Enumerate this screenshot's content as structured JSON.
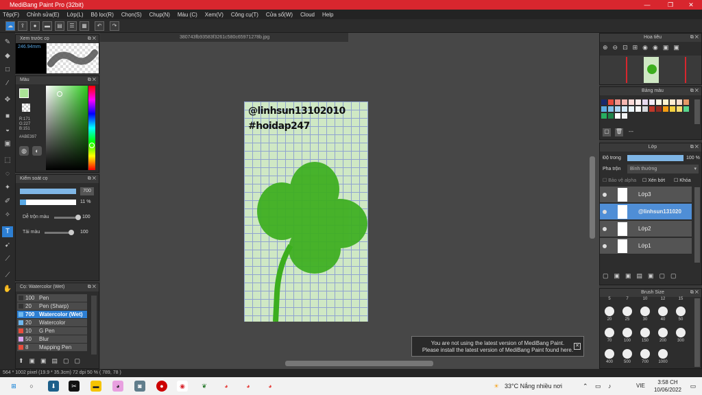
{
  "window": {
    "title": "MediBang Paint Pro (32bit)",
    "minimize": "—",
    "maximize": "❐",
    "close": "✕"
  },
  "menu": [
    "Tệp(F)",
    "Chỉnh sửa(E)",
    "Lớp(L)",
    "Bộ lọc(R)",
    "Chọn(S)",
    "Chụp(N)",
    "Màu (C)",
    "Xem(V)",
    "Công cụ(T)",
    "Cửa sổ(W)",
    "Cloud",
    "Help"
  ],
  "toolbar": {
    "undo": "↶",
    "redo": "↷"
  },
  "brush_preview": {
    "title": "Xem trước cọ",
    "size": "246.94mm"
  },
  "color": {
    "title": "Màu",
    "r": "R:171",
    "g": "G:227",
    "b": "B:151",
    "hex": "#ABE397",
    "value": "#ABE397"
  },
  "brush_control": {
    "title": "Kiểm soát cọ",
    "size_value": "700",
    "opacity_value": "11 %",
    "opacity_fraction": 0.11,
    "blend_label": "Dễ trộn màu",
    "blend_value": "100",
    "reload_label": "Tải màu",
    "reload_value": "100"
  },
  "brush_list": {
    "title": "Cọ: Watercolor (Wet)",
    "items": [
      {
        "size": "100",
        "name": "Pen",
        "color": "#333333"
      },
      {
        "size": "20",
        "name": "Pen (Sharp)",
        "color": "#333333"
      },
      {
        "size": "700",
        "name": "Watercolor (Wet)",
        "color": "#6fb8ee",
        "selected": true
      },
      {
        "size": "20",
        "name": "Watercolor",
        "color": "#6fb8ee"
      },
      {
        "size": "10",
        "name": "G Pen",
        "color": "#e74c3c"
      },
      {
        "size": "50",
        "name": "Blur",
        "color": "#d9a2f0"
      },
      {
        "size": "8",
        "name": "Mapping Pen",
        "color": "#e74c3c"
      }
    ]
  },
  "document": {
    "tab": "380743fb93583f3261c580c65971278b.jpg",
    "line1": "@linhsun13102010",
    "line2": "#hoidap247"
  },
  "navigator": {
    "title": "Hoa tiêu"
  },
  "palette": {
    "title": "Bảng màu",
    "label": "---",
    "colors": [
      "#1a2a6c",
      "#e74c3c",
      "#f1948a",
      "#f5b7b1",
      "#fadbd8",
      "#fdedec",
      "#e8daef",
      "#f4ecf7",
      "#fef9e7",
      "#fcf3cf",
      "#fdebd0",
      "#f6ddcc",
      "#e59866",
      "#5dade2",
      "#85c1e9",
      "#aed6f1",
      "#d6eaf8",
      "#ebf5fb",
      "#f8f9f9",
      "#d5d8dc",
      "#c0392b",
      "#922b21",
      "#f39c12",
      "#f4d03f",
      "#f7dc6f",
      "#58d68d",
      "#27ae60",
      "#1e8449",
      "#ffffff",
      "#f2f3f4"
    ]
  },
  "layers": {
    "title": "Lớp",
    "opacity_label": "Độ trong",
    "opacity_value": "100 %",
    "opacity_fraction": 1.0,
    "blend_label": "Pha trộn",
    "blend_value": "Bình thường",
    "protect_alpha": "Bảo vệ alpha",
    "clipping": "Xén bớt",
    "lock": "Khóa",
    "items": [
      {
        "name": "Lớp3",
        "selected": false
      },
      {
        "name": "@linhsun131020",
        "selected": true
      },
      {
        "name": "Lớp2",
        "selected": false
      },
      {
        "name": "Lớp1",
        "selected": false
      }
    ]
  },
  "brush_size": {
    "title": "Brush Size",
    "header": [
      "5",
      "7",
      "10",
      "12",
      "15"
    ],
    "sizes": [
      "20",
      "25",
      "30",
      "40",
      "50",
      "70",
      "100",
      "150",
      "200",
      "300",
      "400",
      "500",
      "700",
      "1000"
    ]
  },
  "toast": {
    "line1": "You are not using the latest version of MediBang Paint.",
    "line2": "Please install the latest version of MediBang Paint found here.",
    "close": "✕"
  },
  "status": "564 * 1002 pixel  (19.9 * 35.3cm)  72 dpi  50 %  ( 789, 78 )",
  "taskbar": {
    "weather": "33°C  Nắng nhiều nơi",
    "lang": "VIE",
    "time": "3:58 CH",
    "date": "10/06/2022"
  }
}
